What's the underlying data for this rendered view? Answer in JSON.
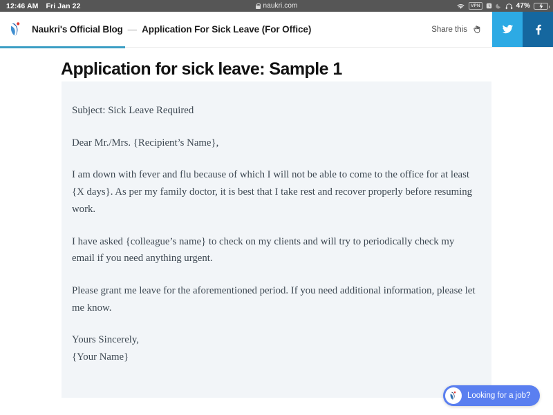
{
  "status_bar": {
    "time": "12:46 AM",
    "date": "Fri Jan 22",
    "url": "naukri.com",
    "lock_icon": "lock-icon",
    "wifi_icon": "wifi-icon",
    "vpn_badge": "VPN",
    "alarm_icon": "alarm-clock-icon",
    "moon_icon": "do-not-disturb-moon-icon",
    "headphones_icon": "headphones-icon",
    "battery_percent": "47%",
    "battery_charging_icon": "battery-charging-icon",
    "background_color": "#565656"
  },
  "page_header": {
    "logo_icon": "naukri-logo-icon",
    "brand": "Naukri's Official Blog",
    "separator": "—",
    "page_title": "Application For Sick Leave (For Office)",
    "share_label": "Share this",
    "share_pointer_icon": "pointing-hand-icon",
    "twitter_icon": "twitter-bird-icon",
    "facebook_icon": "facebook-f-icon",
    "twitter_color": "#2daae4",
    "facebook_color": "#15679f",
    "progress_color": "#3b9ec4"
  },
  "article": {
    "title": "Application for sick leave: Sample 1",
    "card_background": "#f2f5f8",
    "paragraphs": [
      "Subject: Sick Leave Required",
      "Dear Mr./Mrs. {Recipient’s Name},",
      "I am down with fever and flu because of which I will not be able to come to the office for at least {X days}. As per my family doctor, it is best that I take rest and recover properly before resuming work.",
      "I have asked {colleague’s name} to check on my clients and will try to periodically check my email if you need anything urgent.",
      "Please grant me leave for the aforementioned period. If you need additional information, please let me know.",
      "Yours Sincerely,",
      "{Your Name}"
    ]
  },
  "chat_widget": {
    "avatar_icon": "naukri-logo-icon",
    "label": "Looking for a job?",
    "color": "#5a7ff0"
  }
}
